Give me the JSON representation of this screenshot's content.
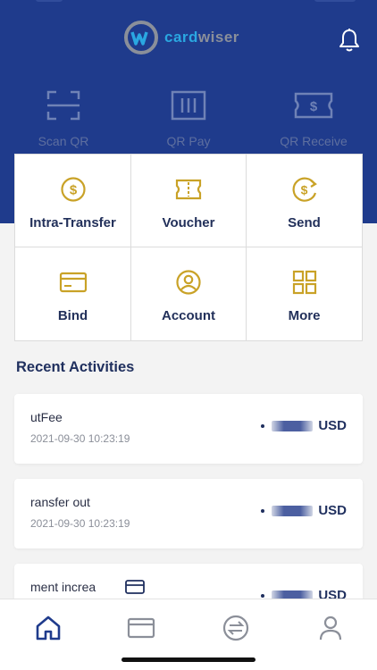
{
  "app": {
    "brand_a": "card",
    "brand_b": "wiser"
  },
  "quick_actions": [
    {
      "label": "Scan QR",
      "icon": "scan-qr-icon"
    },
    {
      "label": "QR Pay",
      "icon": "qr-pay-icon"
    },
    {
      "label": "QR Receive",
      "icon": "qr-receive-icon"
    }
  ],
  "services": [
    {
      "label": "Intra-Transfer",
      "icon": "dollar-coin-icon"
    },
    {
      "label": "Voucher",
      "icon": "voucher-icon"
    },
    {
      "label": "Send",
      "icon": "send-money-icon"
    },
    {
      "label": "Bind",
      "icon": "card-icon"
    },
    {
      "label": "Account",
      "icon": "user-circle-icon"
    },
    {
      "label": "More",
      "icon": "grid-icon"
    }
  ],
  "recent": {
    "title": "Recent Activities",
    "items": [
      {
        "title": "utFee",
        "date": "2021-09-30 10:23:19",
        "currency": "USD"
      },
      {
        "title": "ransfer out",
        "date": "2021-09-30 10:23:19",
        "currency": "USD"
      },
      {
        "title": "ment increa",
        "date": "",
        "currency": "USD"
      }
    ]
  },
  "tabs": [
    {
      "name": "home-icon"
    },
    {
      "name": "card-icon"
    },
    {
      "name": "exchange-icon"
    },
    {
      "name": "profile-icon"
    }
  ],
  "colors": {
    "header_bg": "#1f3b8c",
    "accent_gold": "#c9a227",
    "text_dark": "#1f2f5e"
  }
}
